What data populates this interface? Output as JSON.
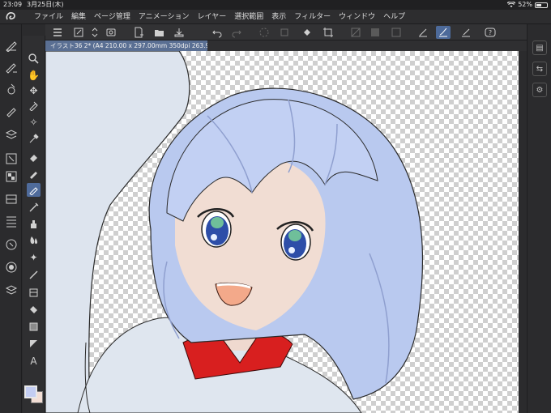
{
  "status_bar": {
    "time": "23:09",
    "date": "3月25日(木)",
    "battery": "52%",
    "battery_level": 0.52
  },
  "menu": {
    "items": [
      "ファイル",
      "編集",
      "ページ管理",
      "アニメーション",
      "レイヤー",
      "選択範囲",
      "表示",
      "フィルター",
      "ウィンドウ",
      "ヘルプ"
    ]
  },
  "document": {
    "tab_title": "イラスト36 2* (A4 210.00 x 297.00mm 350dpi 263.9%)"
  },
  "colors": {
    "main": "#c3cdf2",
    "sub": "#f3ded5",
    "accent": "#4f6b9b",
    "hair": "#b9c9ef",
    "collar": "#d81f1f"
  },
  "command_bar_icons": [
    "menu-icon",
    "new-icon",
    "updown-icon",
    "camera-icon",
    "new-file-icon",
    "open-icon",
    "save-icon",
    "undo-icon",
    "redo-icon",
    "loading-icon",
    "transform-icon",
    "fill-icon",
    "crop-icon",
    "rotate-icon",
    "grid-icon",
    "ruler-icon",
    "snap-icon",
    "pen-icon",
    "brush-icon",
    "pencil-icon",
    "help-icon"
  ],
  "tool_icons": [
    "zoom-icon",
    "hand-icon",
    "move-icon",
    "pen-tool-icon",
    "wand-icon",
    "eyedropper-icon",
    "eraser-icon",
    "fill-brush-icon",
    "pencil-tool-icon",
    "brush-tool-icon",
    "airbrush-icon",
    "blend-icon",
    "decoration-icon",
    "line-icon",
    "layer-icon",
    "bucket-icon",
    "gradient-icon",
    "shape-icon",
    "text-icon"
  ]
}
